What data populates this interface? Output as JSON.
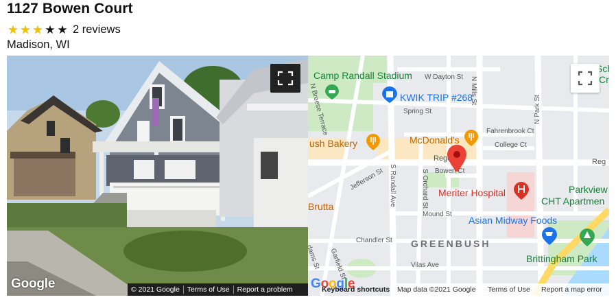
{
  "listing": {
    "title": "1127 Bowen Court",
    "rating": 3,
    "max_rating": 5,
    "reviews_text": "2 reviews",
    "location": "Madison, WI"
  },
  "street_view": {
    "watermark": "Google",
    "footer": {
      "copyright": "© 2021 Google",
      "terms": "Terms of Use",
      "report": "Report a problem"
    },
    "expand_icon": "fullscreen-icon"
  },
  "map": {
    "expand_icon": "fullscreen-icon",
    "watermark": "Google",
    "footer": {
      "shortcuts": "Keyboard shortcuts",
      "map_data": "Map data ©2021 Google",
      "terms": "Terms of Use",
      "report": "Report a map error"
    },
    "pois": {
      "stadium": "Camp Randall Stadium",
      "kwik_trip": "KWIK TRIP #268",
      "bakery": "ush Bakery",
      "mcdonalds": "McDonald's",
      "hospital": "Meriter Hospital",
      "asian_foods": "Asian Midway Foods",
      "brittingham": "Brittingham Park",
      "parkview_1": "Parkview",
      "parkview_2": "CHT Apartmen",
      "brutta": "Brutta",
      "top_right_1": "Sch",
      "top_right_2": "Cr"
    },
    "streets": {
      "w_dayton": "W Dayton St",
      "n_mills": "N Mills St",
      "spring": "Spring St",
      "fahrenbrook": "Fahrenbrook Ct",
      "college": "College Ct",
      "n_park": "N Park St",
      "regent": "Regent",
      "regent_right": "Reg",
      "bowen": "Bowen Ct",
      "jefferson": "Jefferson St",
      "s_randall": "S Randall Ave",
      "s_orchard": "S Orchard St",
      "mound": "Mound St",
      "chandler": "Chandler St",
      "vilas": "Vilas Ave",
      "garfield": "Garfield St",
      "adams": "dams St",
      "n_breese": "N Breese Terrace"
    },
    "neighborhood": "GREENBUSH",
    "colors": {
      "pin": "#ea4335",
      "hospital": "#d93025",
      "restaurant": "#f29900",
      "shopping": "#1a73e8",
      "park": "#34a853"
    }
  }
}
